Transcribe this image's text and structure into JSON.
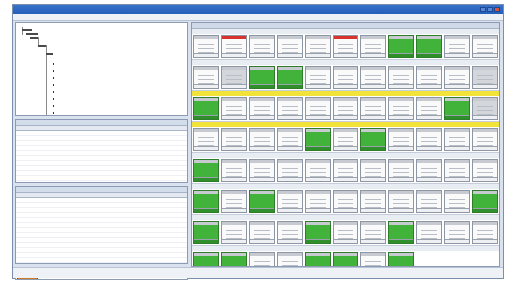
{
  "window": {
    "title": "",
    "menu": []
  },
  "status": {
    "text": "",
    "right": ""
  },
  "colors": {
    "accent": "#245fb9",
    "ok": "#42b33a",
    "alert": "#d9342b",
    "highlight": "#f2e33a"
  },
  "legend_colors": [
    "#5fb6c9",
    "#d8c31d",
    "#4bb04a",
    "#2f2f2f",
    "#3f6ad1",
    "#c9453e",
    "#2e2e2e",
    "#d17a23"
  ],
  "groups": [
    {
      "highlight": false,
      "tiles": [
        "white",
        "red",
        "white",
        "white",
        "white",
        "red",
        "white",
        "green",
        "green",
        "white",
        "white"
      ]
    },
    {
      "highlight": false,
      "tiles": [
        "white",
        "gray",
        "green",
        "green",
        "white",
        "white",
        "white",
        "white",
        "white",
        "white",
        "gray"
      ]
    },
    {
      "highlight": true,
      "tiles": [
        "green",
        "white",
        "white",
        "white",
        "white",
        "white",
        "white",
        "white",
        "white",
        "green",
        "gray"
      ]
    },
    {
      "highlight": true,
      "tiles": [
        "white",
        "white",
        "white",
        "white",
        "green",
        "white",
        "green",
        "white",
        "white",
        "white",
        "white"
      ]
    },
    {
      "highlight": false,
      "tiles": [
        "green",
        "white",
        "white",
        "white",
        "white",
        "white",
        "white",
        "white",
        "white",
        "white",
        "white"
      ]
    },
    {
      "highlight": false,
      "tiles": [
        "green",
        "white",
        "green",
        "white",
        "white",
        "white",
        "white",
        "white",
        "white",
        "white",
        "green"
      ]
    },
    {
      "highlight": false,
      "tiles": [
        "green",
        "white",
        "white",
        "white",
        "green",
        "white",
        "white",
        "green",
        "white",
        "white",
        "white"
      ]
    },
    {
      "highlight": false,
      "tiles": [
        "green",
        "green",
        "white",
        "white",
        "green",
        "green",
        "white",
        "green",
        "empty",
        "empty",
        "empty"
      ]
    }
  ]
}
